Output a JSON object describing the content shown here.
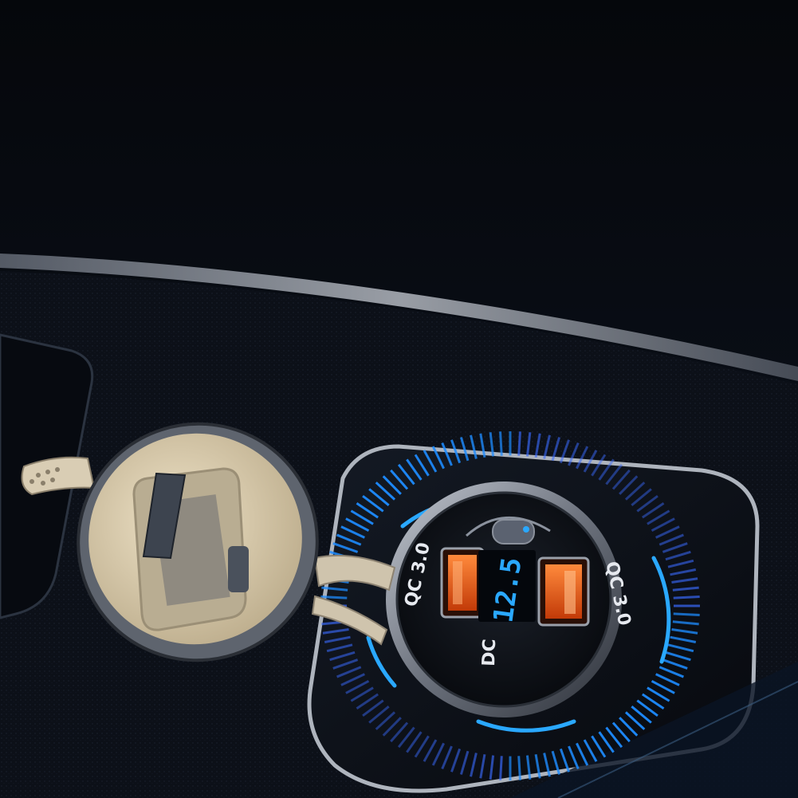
{
  "product": {
    "left_port_label": "QC 3.0",
    "right_port_label": "QC 3.0",
    "bottom_label": "DC",
    "voltage_reading": "12.5"
  },
  "colors": {
    "display_blue": "#2aa8ff",
    "usb_orange": "#ff6a1a",
    "glow_blue": "#1f8fff",
    "cap_beige": "#d9cdb4",
    "leather_dark": "#0c1018"
  },
  "icons": {
    "lid": "dust-cap-icon",
    "ring": "glow-ring-icon"
  }
}
